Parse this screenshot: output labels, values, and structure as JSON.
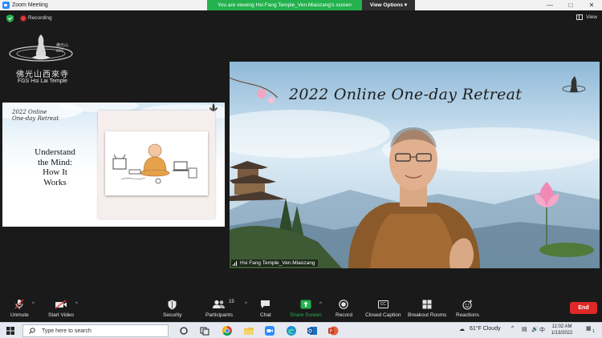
{
  "window": {
    "title": "Zoom Meeting"
  },
  "banner": {
    "message": "You are viewing Hsi Fang Temple_Ven.Miaozang's screen",
    "options_label": "View Options"
  },
  "meeting": {
    "recording_label": "Recording",
    "view_label": "View"
  },
  "temple": {
    "name_cn": "佛光山西來寺",
    "name_en": "FGS Hsi Lai Temple",
    "seal_text": "IBPS"
  },
  "shared_screen": {
    "corner_title_line1": "2022 Online",
    "corner_title_line2": "One-day Retreat",
    "heading_line1": "Understand",
    "heading_line2": "the Mind:",
    "heading_line3": "How It",
    "heading_line4": "Works"
  },
  "video": {
    "background_title": "2022 Online One-day Retreat",
    "participant_name": "Hsi Fang Temple_Ven.Miaozang"
  },
  "toolbar": {
    "unmute": "Unmute",
    "start_video": "Start Video",
    "security": "Security",
    "participants": "Participants",
    "participants_count": "15",
    "chat": "Chat",
    "share_screen": "Share Screen",
    "record": "Record",
    "closed_caption": "Closed Caption",
    "closed_caption_icon_text": "CC",
    "breakout_rooms": "Breakout Rooms",
    "reactions": "Reactions",
    "end": "End"
  },
  "taskbar": {
    "search_placeholder": "Type here to search",
    "weather": "61°F  Cloudy",
    "input_lang": "中",
    "time": "11:02 AM",
    "date": "1/13/2022",
    "notification_count": "1"
  },
  "colors": {
    "share_green": "#23b14d",
    "end_red": "#e02828",
    "zoom_blue": "#2d8cff"
  }
}
